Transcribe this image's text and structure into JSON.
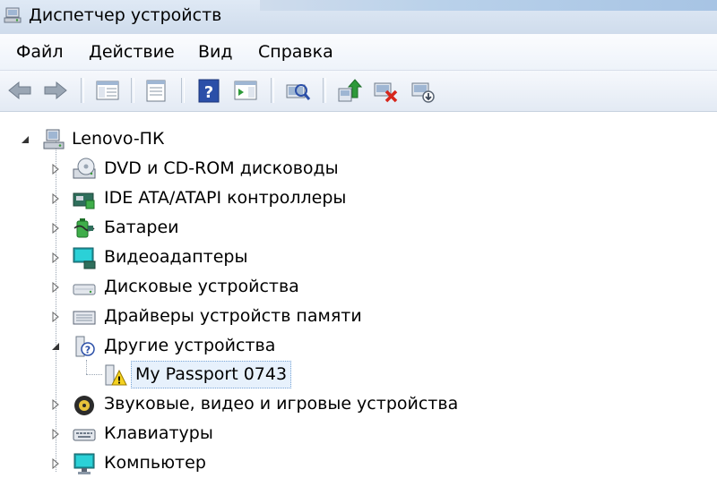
{
  "window": {
    "title": "Диспетчер устройств",
    "icon": "device-manager-icon"
  },
  "menu": {
    "items": [
      {
        "label": "Файл"
      },
      {
        "label": "Действие"
      },
      {
        "label": "Вид"
      },
      {
        "label": "Справка"
      }
    ]
  },
  "toolbar": {
    "buttons": [
      "back-arrow-icon",
      "forward-arrow-icon",
      "show-hide-console-tree-icon",
      "properties-icon",
      "help-icon",
      "show-hide-action-pane-icon",
      "scan-hardware-icon",
      "update-driver-icon",
      "uninstall-icon",
      "disable-device-icon"
    ],
    "colors": {
      "arrow": "#8a97a6",
      "help_blue": "#2b4fa8",
      "error_red": "#d6261c",
      "update_green": "#2e9a3a"
    }
  },
  "tree": {
    "root": {
      "label": "Lenovo-ПК",
      "expanded": true,
      "icon": "computer-root-icon"
    },
    "categories": [
      {
        "label": "DVD и CD-ROM дисководы",
        "icon": "dvd-drive-icon",
        "expanded": false
      },
      {
        "label": "IDE ATA/ATAPI контроллеры",
        "icon": "ide-controller-icon",
        "expanded": false
      },
      {
        "label": "Батареи",
        "icon": "battery-icon",
        "expanded": false
      },
      {
        "label": "Видеоадаптеры",
        "icon": "display-adapter-icon",
        "expanded": false
      },
      {
        "label": "Дисковые устройства",
        "icon": "disk-drive-icon",
        "expanded": false
      },
      {
        "label": "Драйверы устройств памяти",
        "icon": "memory-driver-icon",
        "expanded": false
      },
      {
        "label": "Другие устройства",
        "icon": "unknown-device-icon",
        "expanded": true,
        "children": [
          {
            "label": "My Passport 0743",
            "icon": "warning-device-icon",
            "selected": true,
            "status": "warning"
          }
        ]
      },
      {
        "label": "Звуковые, видео и игровые устройства",
        "icon": "speaker-icon",
        "expanded": false
      },
      {
        "label": "Клавиатуры",
        "icon": "keyboard-icon",
        "expanded": false
      },
      {
        "label": "Компьютер",
        "icon": "computer-icon",
        "expanded": false
      }
    ]
  }
}
